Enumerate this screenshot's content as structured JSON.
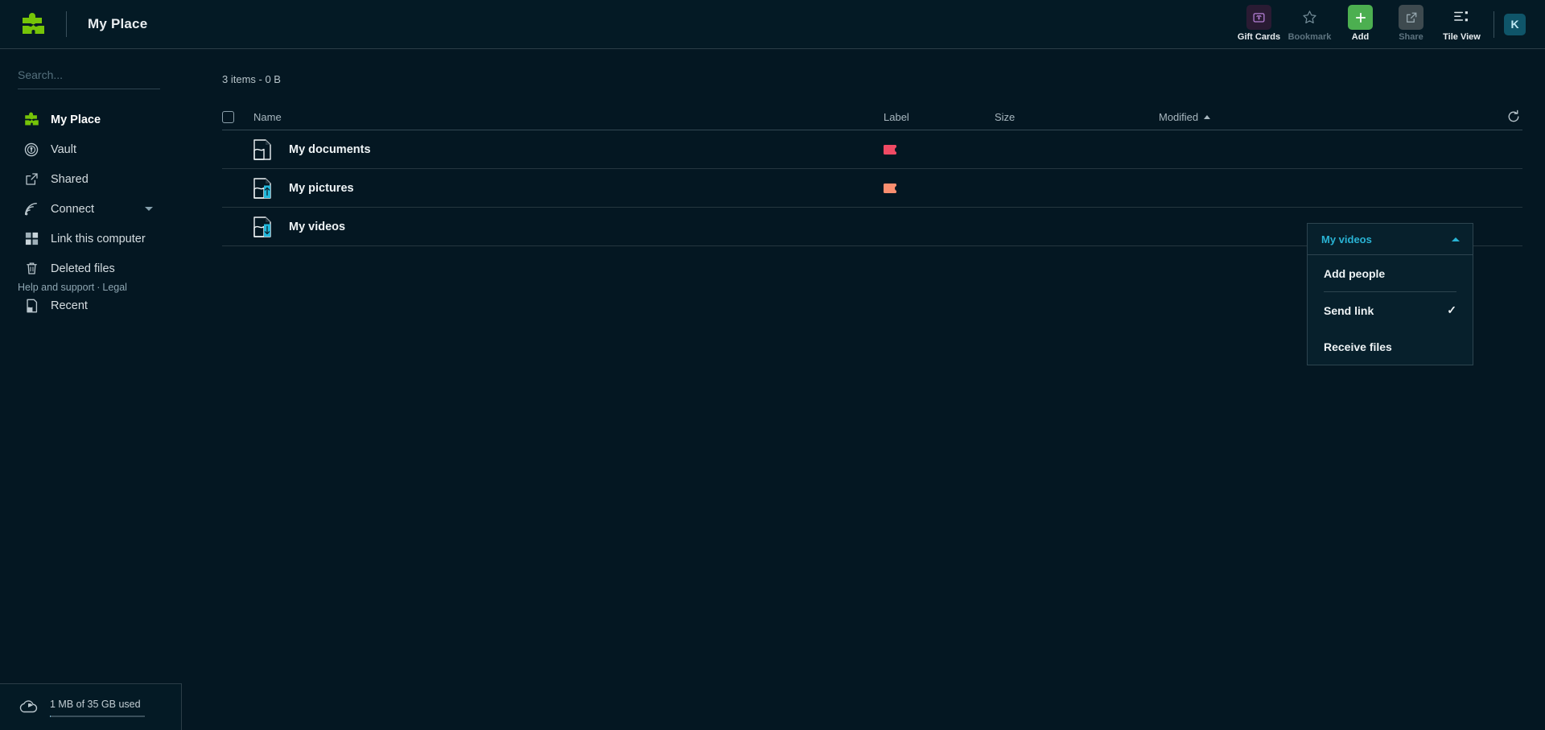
{
  "app": {
    "title": "My Place",
    "logo_icon": "puzzle-logo-icon",
    "brand_color": "#76c408"
  },
  "toolbar": {
    "items": [
      {
        "label": "Gift Cards",
        "icon": "gift-card-icon",
        "dim": false
      },
      {
        "label": "Bookmark",
        "icon": "star-icon",
        "dim": true
      },
      {
        "label": "Add",
        "icon": "plus-icon",
        "dim": false
      },
      {
        "label": "Share",
        "icon": "share-external-icon",
        "dim": true
      },
      {
        "label": "Tile View",
        "icon": "tile-view-icon",
        "dim": false
      }
    ],
    "avatar_initial": "K"
  },
  "sidebar": {
    "search": {
      "placeholder": "Search...",
      "value": "",
      "icon": "search-input"
    },
    "items": [
      {
        "label": "My Place",
        "icon": "puzzle-logo-icon",
        "active": true,
        "chevron": false
      },
      {
        "label": "Vault",
        "icon": "vault-lock-icon",
        "active": false,
        "chevron": false
      },
      {
        "label": "Shared",
        "icon": "share-external-icon",
        "active": false,
        "chevron": false
      },
      {
        "label": "Connect",
        "icon": "broadcast-icon",
        "active": false,
        "chevron": true
      },
      {
        "label": "Link this computer",
        "icon": "grid-icon",
        "active": false,
        "chevron": false
      },
      {
        "label": "Deleted files",
        "icon": "trash-icon",
        "active": false,
        "chevron": false
      },
      {
        "label": "Recent",
        "icon": "recent-document-icon",
        "active": false,
        "chevron": false
      }
    ],
    "footer": {
      "help_label": "Help and support",
      "separator": "·",
      "legal_label": "Legal"
    },
    "storage": {
      "icon": "cloud-icon",
      "text": "1 MB of 35 GB used",
      "percent": 0
    }
  },
  "main": {
    "summary": "3 items - 0 B",
    "columns": {
      "name": "Name",
      "label": "Label",
      "size": "Size",
      "modified": "Modified"
    },
    "sort": {
      "column": "Modified",
      "direction": "asc"
    },
    "refresh_icon": "refresh-icon",
    "select_all_checked": false,
    "rows": [
      {
        "name": "My documents",
        "icon": "file-document-icon",
        "badge": "none",
        "label_color": "#f04a64",
        "size": "",
        "modified": ""
      },
      {
        "name": "My pictures",
        "icon": "file-document-icon",
        "badge": "upload-arrow-icon",
        "label_color": "#fa8e6f",
        "size": "",
        "modified": ""
      },
      {
        "name": "My videos",
        "icon": "file-document-icon",
        "badge": "download-arrow-icon",
        "label_color": "",
        "size": "",
        "modified": ""
      }
    ]
  },
  "dropdown": {
    "title": "My videos",
    "chevron_icon": "chevron-up-icon",
    "accent_color": "#29b3d4",
    "items": [
      {
        "label": "Add people",
        "checked": false
      },
      {
        "label": "Send link",
        "checked": true
      },
      {
        "label": "Receive files",
        "checked": false
      }
    ],
    "check_glyph": "✓"
  }
}
